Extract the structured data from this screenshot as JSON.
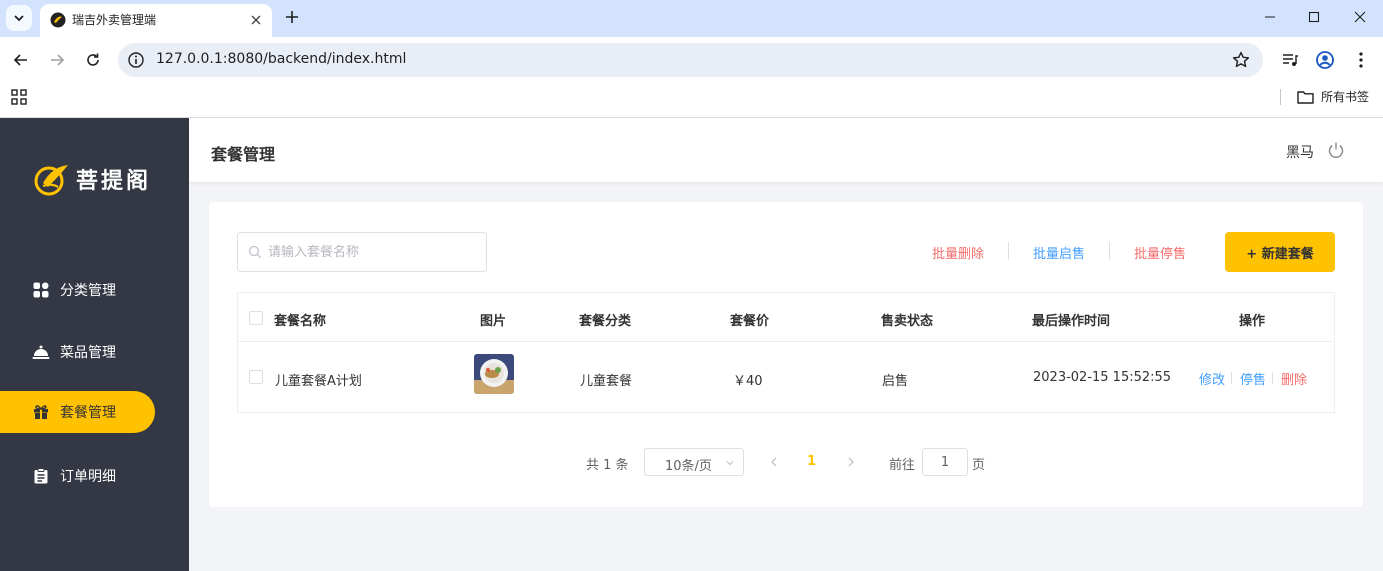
{
  "browser": {
    "tab_title": "瑞吉外卖管理端",
    "url": "127.0.0.1:8080/backend/index.html",
    "bookmarks_all": "所有书签"
  },
  "sidebar": {
    "logo_text": "菩提阁",
    "items": [
      {
        "label": "分类管理",
        "icon": "category-grid-icon",
        "active": false
      },
      {
        "label": "菜品管理",
        "icon": "cloche-icon",
        "active": false
      },
      {
        "label": "套餐管理",
        "icon": "gift-icon",
        "active": true
      },
      {
        "label": "订单明细",
        "icon": "clipboard-icon",
        "active": false
      }
    ]
  },
  "header": {
    "title": "套餐管理",
    "username": "黑马"
  },
  "toolbar": {
    "search_placeholder": "请输入套餐名称",
    "batch_delete": "批量删除",
    "batch_enable": "批量启售",
    "batch_disable": "批量停售",
    "new_button": "+ 新建套餐"
  },
  "table": {
    "columns": [
      "套餐名称",
      "图片",
      "套餐分类",
      "套餐价",
      "售卖状态",
      "最后操作时间",
      "操作"
    ],
    "rows": [
      {
        "name": "儿童套餐A计划",
        "category": "儿童套餐",
        "price": "￥40",
        "status": "启售",
        "updated": "2023-02-15 15:52:55",
        "actions": [
          "修改",
          "停售",
          "删除"
        ]
      }
    ]
  },
  "pagination": {
    "total": "共 1 条",
    "page_size": "10条/页",
    "current_page": "1",
    "goto_label": "前往",
    "goto_value": "1",
    "page_suffix": "页"
  },
  "colors": {
    "accent": "#ffc200",
    "sidebar_bg": "#343744",
    "danger": "#f56c6c",
    "link": "#419eff"
  }
}
